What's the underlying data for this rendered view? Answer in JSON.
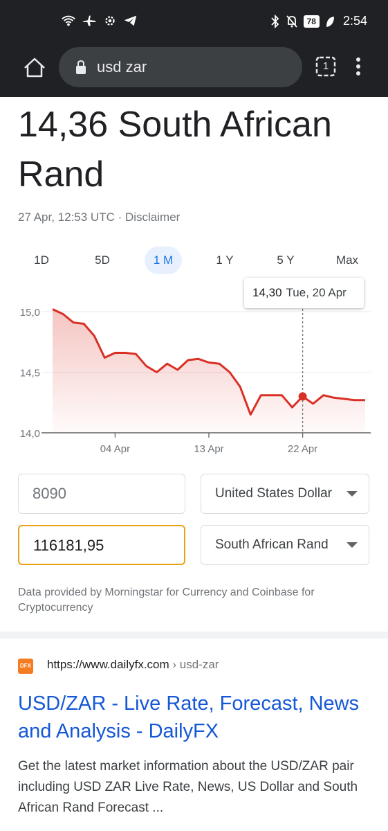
{
  "status_bar": {
    "time": "2:54",
    "battery": "78"
  },
  "browser": {
    "address": "usd zar",
    "tab_count": "1"
  },
  "result": {
    "rate_title": "14,36 South African Rand",
    "timestamp": "27 Apr, 12:53 UTC · ",
    "disclaimer": "Disclaimer"
  },
  "ranges": [
    {
      "label": "1D",
      "active": false
    },
    {
      "label": "5D",
      "active": false
    },
    {
      "label": "1 M",
      "active": true
    },
    {
      "label": "1 Y",
      "active": false
    },
    {
      "label": "5 Y",
      "active": false
    },
    {
      "label": "Max",
      "active": false
    }
  ],
  "tooltip": {
    "value": "14,30",
    "date": "Tue, 20 Apr"
  },
  "chart_data": {
    "type": "area",
    "x_tick_labels": [
      "04 Apr",
      "13 Apr",
      "22 Apr"
    ],
    "y_tick_labels": [
      "15,0",
      "14,5",
      "14,0"
    ],
    "ylim": [
      14.0,
      15.0
    ],
    "x": [
      0,
      1,
      2,
      3,
      4,
      5,
      6,
      7,
      8,
      9,
      10,
      11,
      12,
      13,
      14,
      15,
      16,
      17,
      18,
      19,
      20,
      21,
      22,
      23,
      24,
      25,
      26,
      27,
      28,
      29,
      30
    ],
    "x_ticks": [
      6,
      15,
      24
    ],
    "values": [
      15.02,
      14.98,
      14.91,
      14.9,
      14.8,
      14.62,
      14.66,
      14.66,
      14.65,
      14.55,
      14.5,
      14.57,
      14.52,
      14.6,
      14.61,
      14.58,
      14.57,
      14.5,
      14.38,
      14.15,
      14.31,
      14.31,
      14.31,
      14.21,
      14.3,
      14.24,
      14.31,
      14.29,
      14.28,
      14.27,
      14.27
    ],
    "highlight_index": 24,
    "grid": true,
    "color": "#d93025"
  },
  "converter": {
    "from_value": "8090",
    "from_currency": "United States Dollar",
    "to_value": "116181,95",
    "to_currency": "South African Rand"
  },
  "provider_note": "Data provided by Morningstar for Currency and Coinbase for Cryptocurrency",
  "search_result": {
    "favicon_text": "DFX",
    "url": "https://www.dailyfx.com",
    "breadcrumb": " › usd-zar",
    "title": "USD/ZAR - Live Rate, Forecast, News and Analysis - DailyFX",
    "snippet": "Get the latest market information about the USD/ZAR pair including USD ZAR Live Rate, News, US Dollar and South African Rand Forecast ..."
  }
}
